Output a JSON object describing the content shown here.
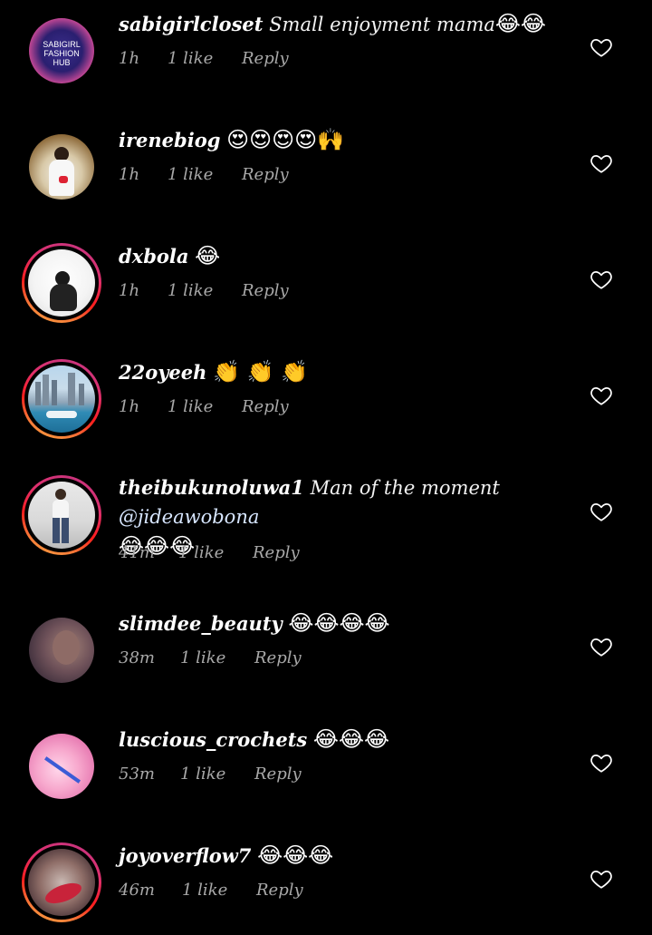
{
  "comments": [
    {
      "username": "sabigirlcloset",
      "message": "Small enjoyment mama",
      "emojis": "😂😂",
      "time": "1h",
      "likes": "1 like",
      "reply": "Reply",
      "avatar_text": "SABIGIRL FASHION HUB"
    },
    {
      "username": "irenebiog",
      "message": "",
      "emojis": "😍😍😍😍🙌",
      "time": "1h",
      "likes": "1 like",
      "reply": "Reply"
    },
    {
      "username": "dxbola",
      "message": "",
      "emojis": "😂",
      "time": "1h",
      "likes": "1 like",
      "reply": "Reply"
    },
    {
      "username": "22oyeeh",
      "message": "",
      "emojis": "👏 👏 👏",
      "time": "1h",
      "likes": "1 like",
      "reply": "Reply"
    },
    {
      "username": "theibukunoluwa1",
      "message": "Man of the moment",
      "mention": "@jideawobona",
      "emojis": "😂😂😂",
      "time": "41m",
      "likes": "1 like",
      "reply": "Reply"
    },
    {
      "username": "slimdee_beauty",
      "message": "",
      "emojis": "😂😂😂😂",
      "time": "38m",
      "likes": "1 like",
      "reply": "Reply"
    },
    {
      "username": "luscious_crochets",
      "message": "",
      "emojis": "😂😂😂",
      "time": "53m",
      "likes": "1 like",
      "reply": "Reply"
    },
    {
      "username": "joyoverflow7",
      "message": "",
      "emojis": "😂😂😂",
      "time": "46m",
      "likes": "1 like",
      "reply": "Reply"
    }
  ],
  "icons": {
    "like": "heart-outline-icon"
  },
  "colors": {
    "background": "#000000",
    "text": "#ffffff",
    "meta": "#a8a8a8",
    "story_ring_start": "#c13584",
    "story_ring_end": "#fcaf45"
  }
}
